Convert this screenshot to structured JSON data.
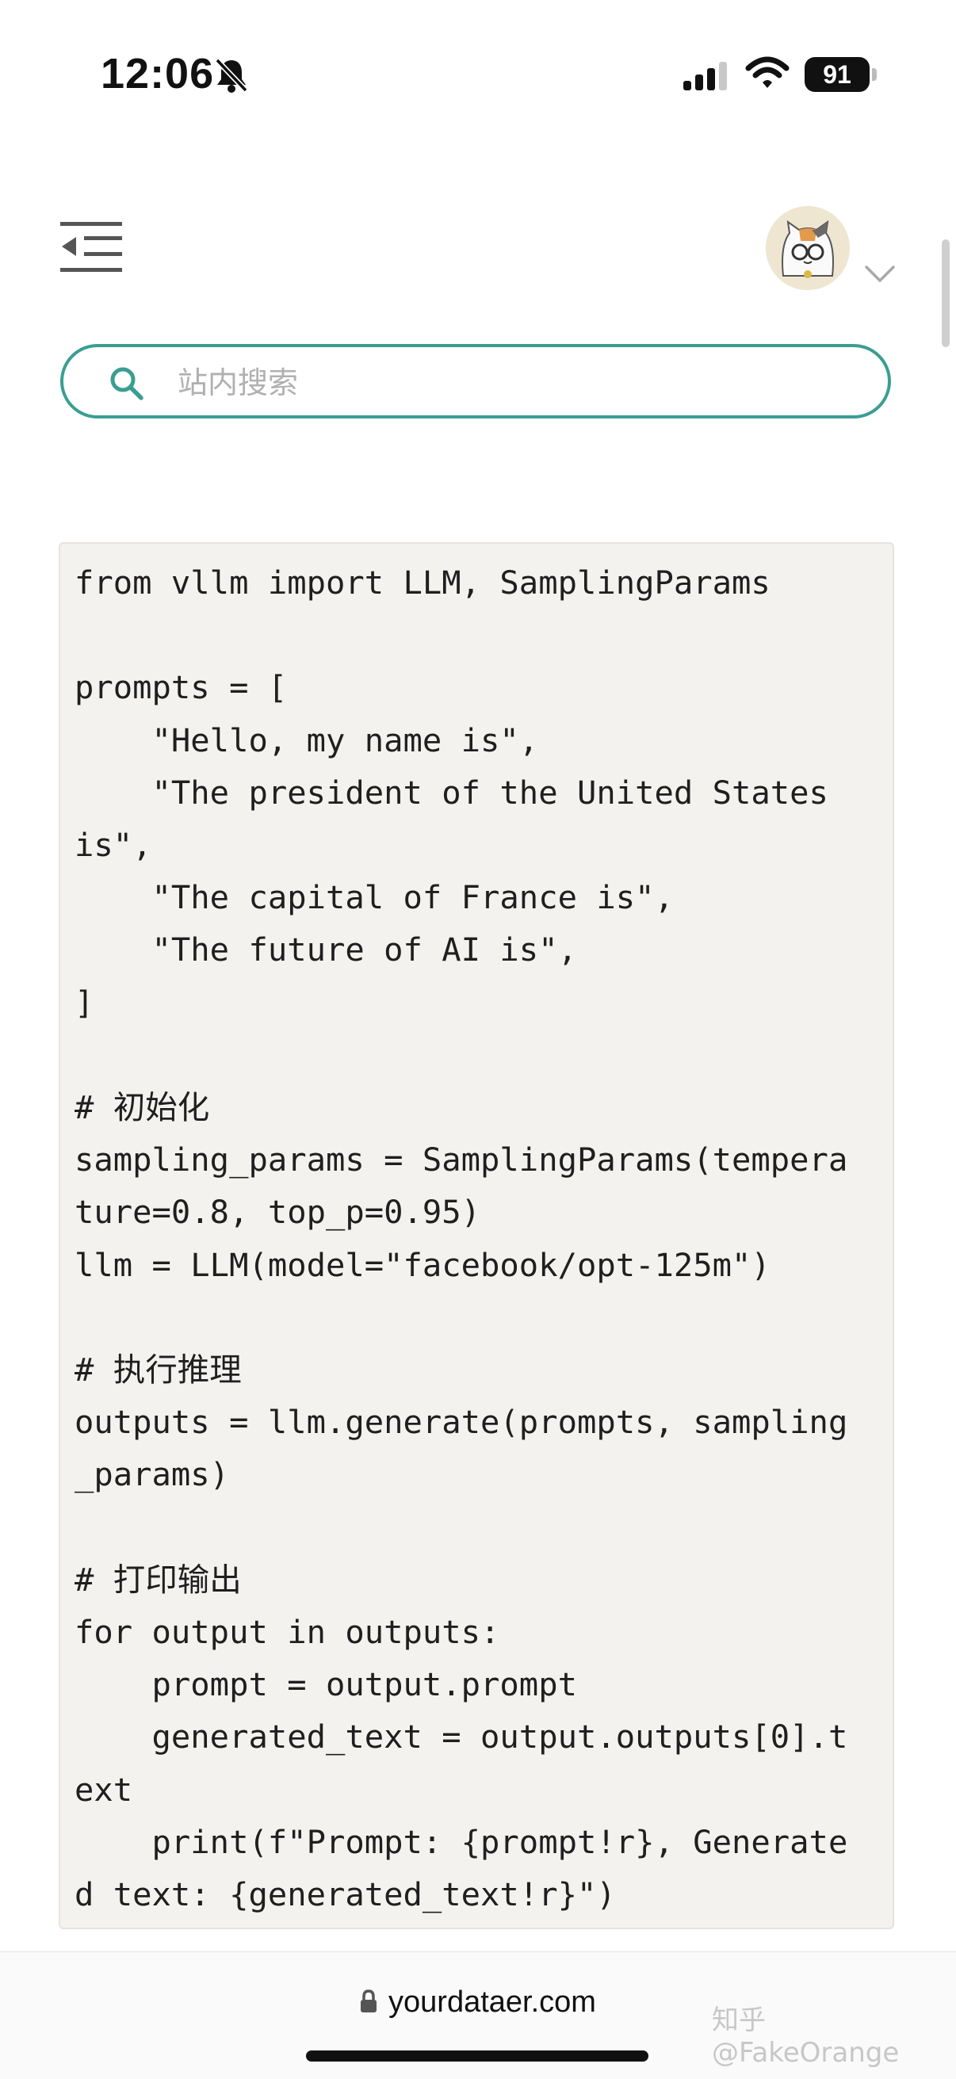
{
  "status_bar": {
    "time": "12:06",
    "battery": "91"
  },
  "header": {
    "menu_icon": "collapse-menu-icon",
    "avatar_icon": "cat-avatar-icon"
  },
  "search": {
    "placeholder": "站内搜索",
    "value": ""
  },
  "code": {
    "lines": [
      "from vllm import LLM, SamplingParams",
      "",
      "prompts = [",
      "    \"Hello, my name is\",",
      "    \"The president of the United States",
      "is\",",
      "    \"The capital of France is\",",
      "    \"The future of AI is\",",
      "]",
      "",
      "# 初始化",
      "sampling_params = SamplingParams(tempera",
      "ture=0.8, top_p=0.95)",
      "llm = LLM(model=\"facebook/opt-125m\")",
      "",
      "# 执行推理",
      "outputs = llm.generate(prompts, sampling",
      "_params)",
      "",
      "# 打印输出",
      "for output in outputs:",
      "    prompt = output.prompt",
      "    generated_text = output.outputs[0].t",
      "ext",
      "    print(f\"Prompt: {prompt!r}, Generate",
      "d text: {generated_text!r}\")"
    ]
  },
  "bottom_bar": {
    "url": "yourdataer.com",
    "watermark": "知乎 @FakeOrange"
  },
  "colors": {
    "accent": "#3a9e92",
    "code_bg": "#f4f2ef"
  }
}
